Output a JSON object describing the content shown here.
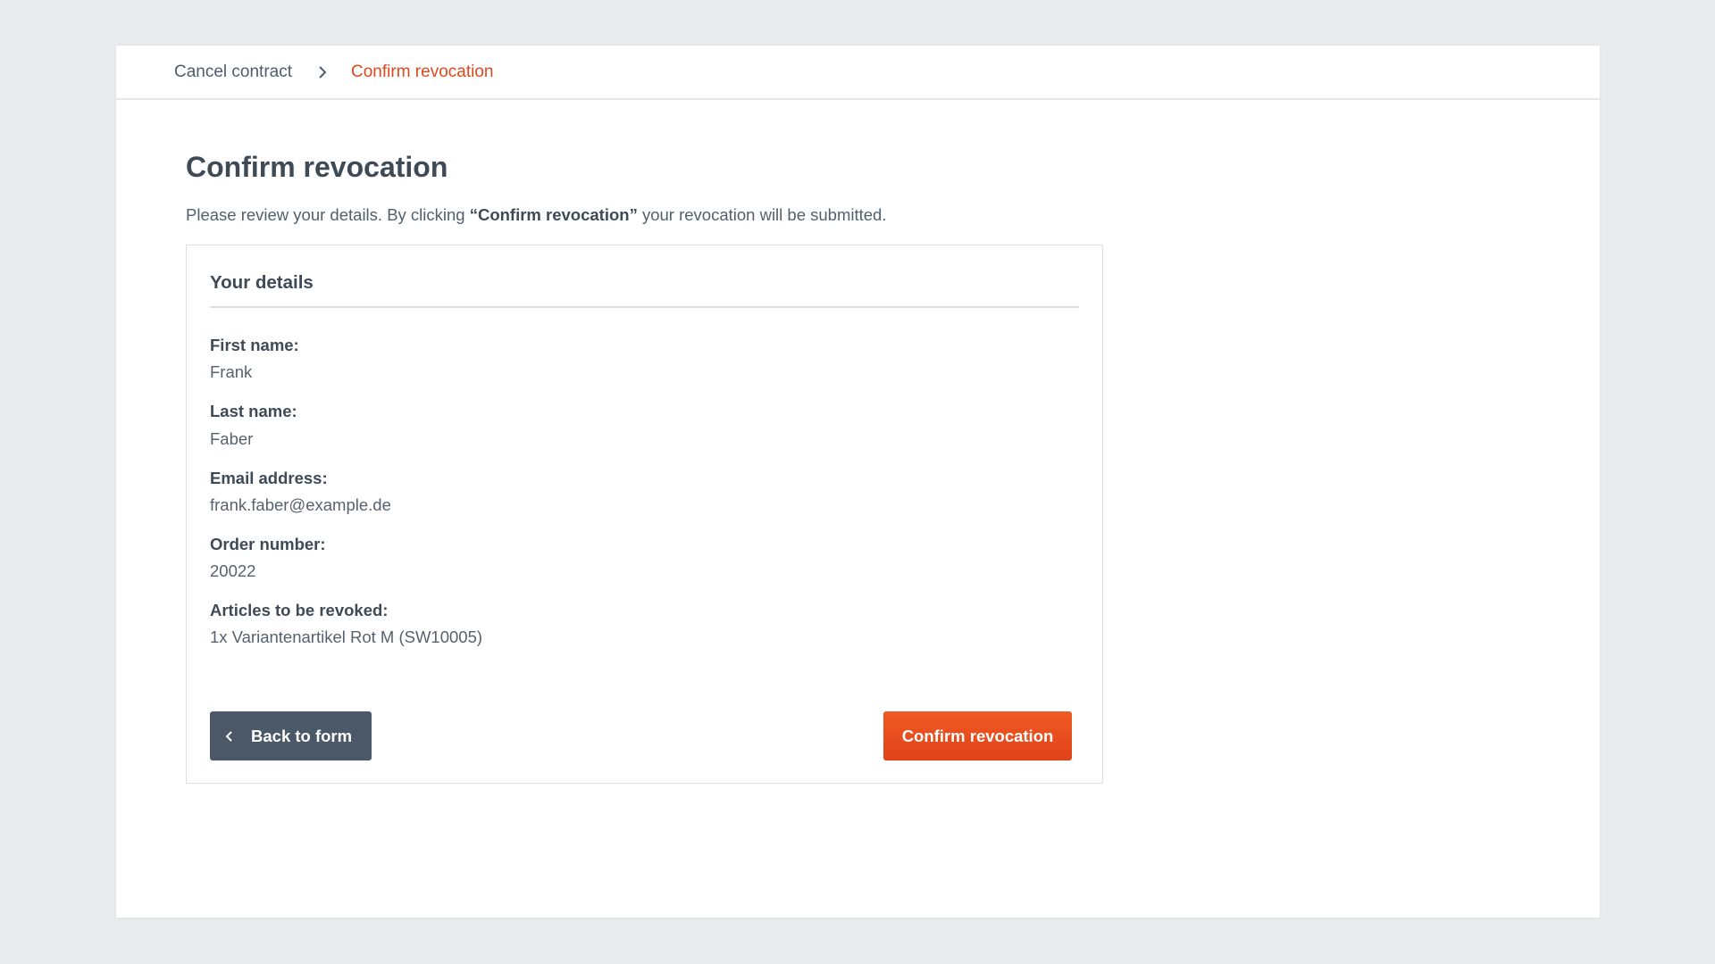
{
  "breadcrumb": {
    "items": [
      {
        "label": "Cancel contract"
      },
      {
        "label": "Confirm revocation"
      }
    ],
    "separator_icon": "chevron-right-icon"
  },
  "main": {
    "title": "Confirm revocation",
    "intro_before": "Please review your details. By clicking ",
    "intro_emphasis": "“Confirm revocation”",
    "intro_after": " your revocation will be submitted."
  },
  "details": {
    "title": "Your details",
    "fields": [
      {
        "label": "First name:",
        "value": "Frank"
      },
      {
        "label": "Last name:",
        "value": "Faber"
      },
      {
        "label": "Email address:",
        "value": "frank.faber@example.de"
      },
      {
        "label": "Order number:",
        "value": "20022"
      },
      {
        "label": "Articles to be revoked:",
        "value": "1x Variantenartikel Rot M (SW10005)"
      }
    ]
  },
  "actions": {
    "back_label": "Back to form",
    "back_icon": "chevron-left-icon",
    "confirm_label": "Confirm revocation"
  },
  "colors": {
    "accent": "#e0481b",
    "secondary_button": "#4a5868",
    "background": "#e9ebef"
  }
}
